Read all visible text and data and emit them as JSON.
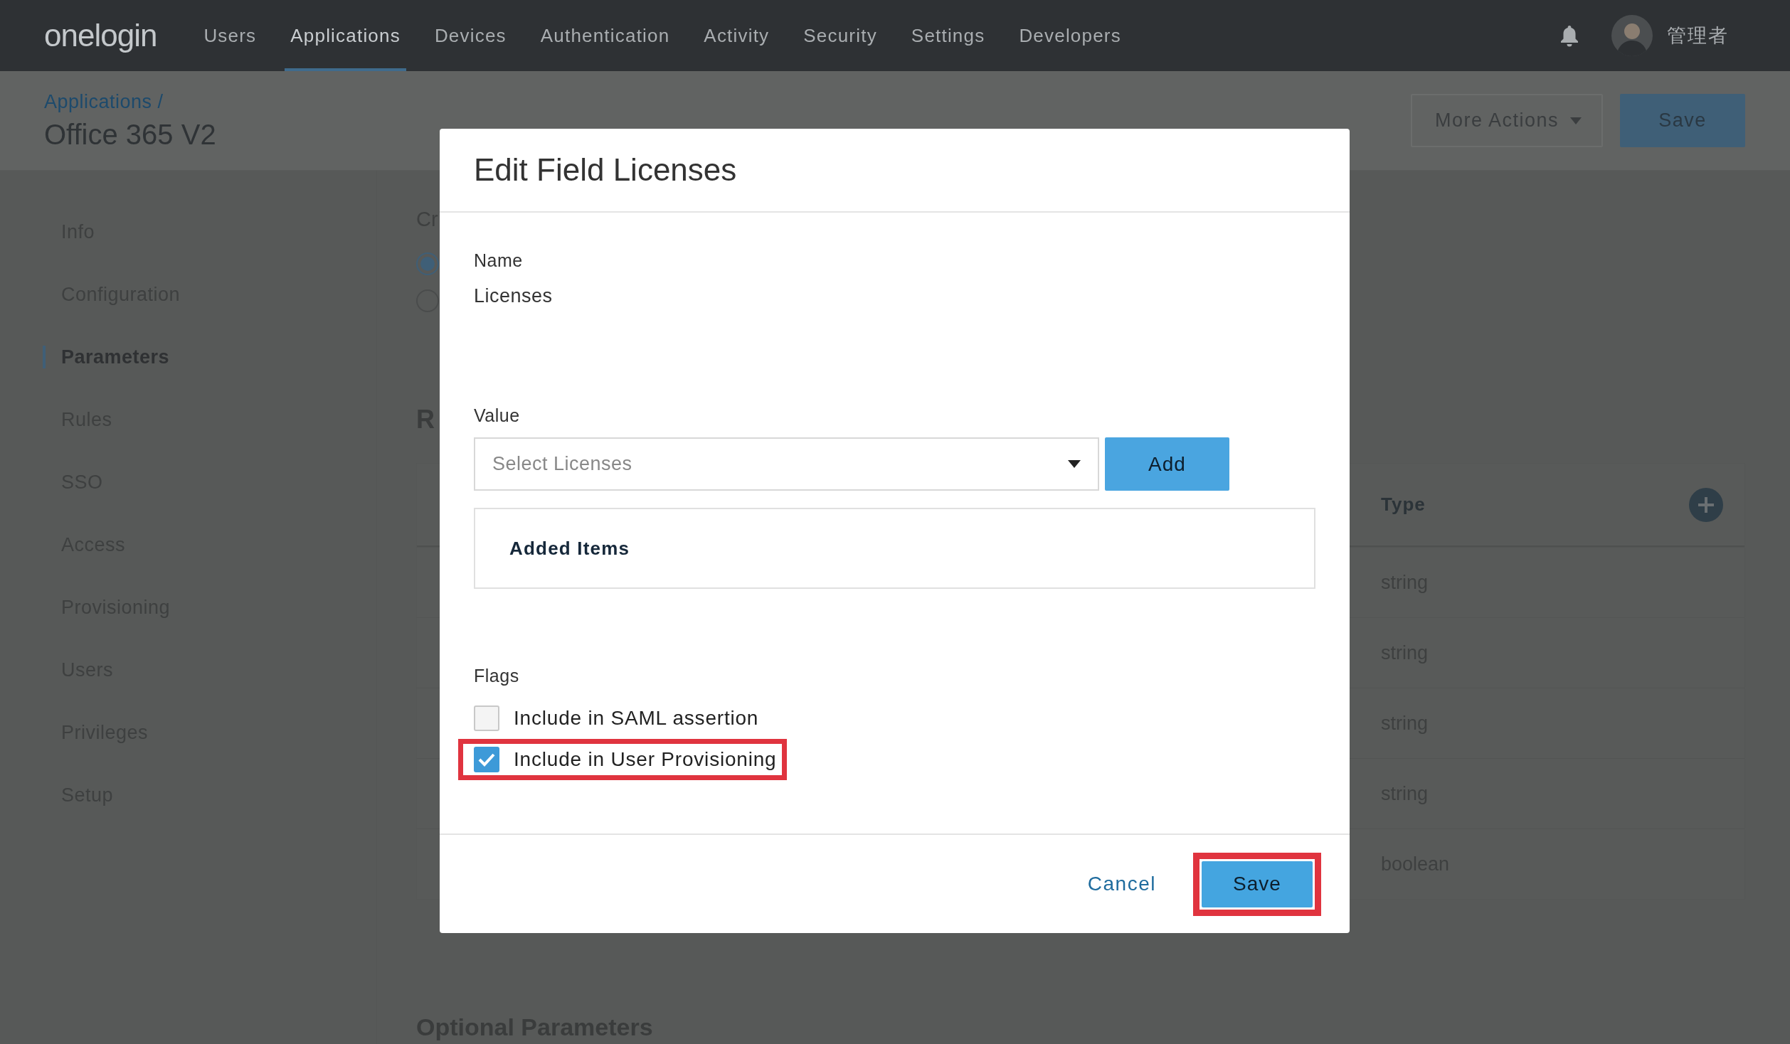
{
  "nav": {
    "logo": "onelogin",
    "items": [
      {
        "label": "Users",
        "selected": false
      },
      {
        "label": "Applications",
        "selected": true
      },
      {
        "label": "Devices",
        "selected": false
      },
      {
        "label": "Authentication",
        "selected": false
      },
      {
        "label": "Activity",
        "selected": false
      },
      {
        "label": "Security",
        "selected": false
      },
      {
        "label": "Settings",
        "selected": false
      },
      {
        "label": "Developers",
        "selected": false
      }
    ],
    "user": "管理者"
  },
  "header": {
    "breadcrumb": "Applications /",
    "title": "Office 365 V2",
    "actions": [
      {
        "label": "More Actions",
        "kind": "menu"
      },
      {
        "label": "Save",
        "kind": "primary"
      }
    ]
  },
  "sidebar": {
    "items": [
      {
        "label": "Info",
        "selected": false
      },
      {
        "label": "Configuration",
        "selected": false
      },
      {
        "label": "Parameters",
        "selected": true
      },
      {
        "label": "Rules",
        "selected": false
      },
      {
        "label": "SSO",
        "selected": false
      },
      {
        "label": "Access",
        "selected": false
      },
      {
        "label": "Provisioning",
        "selected": false
      },
      {
        "label": "Users",
        "selected": false
      },
      {
        "label": "Privileges",
        "selected": false
      },
      {
        "label": "Setup",
        "selected": false
      }
    ]
  },
  "content": {
    "section_label": "Cr",
    "radios": [
      {
        "selected": true
      },
      {
        "selected": false
      }
    ],
    "section_title": "R",
    "table": {
      "columns": [
        "Type"
      ],
      "rows": [
        {
          "type": "string"
        },
        {
          "type": "string"
        },
        {
          "type": "string"
        },
        {
          "type": "string"
        },
        {
          "type": "boolean"
        }
      ]
    },
    "optional_title": "Optional Parameters"
  },
  "dialog": {
    "title": "Edit Field Licenses",
    "name_label": "Name",
    "name_value": "Licenses",
    "value_label": "Value",
    "select": {
      "placeholder": "Select Licenses"
    },
    "add_button": "Add",
    "added_items_title": "Added Items",
    "flags_label": "Flags",
    "flags": [
      {
        "label": "Include in SAML assertion",
        "checked": false,
        "highlighted": false
      },
      {
        "label": "Include in User Provisioning",
        "checked": true,
        "highlighted": true
      }
    ],
    "buttons": [
      {
        "label": "Cancel",
        "kind": "link",
        "highlighted": false
      },
      {
        "label": "Save",
        "kind": "primary",
        "highlighted": true
      }
    ]
  }
}
